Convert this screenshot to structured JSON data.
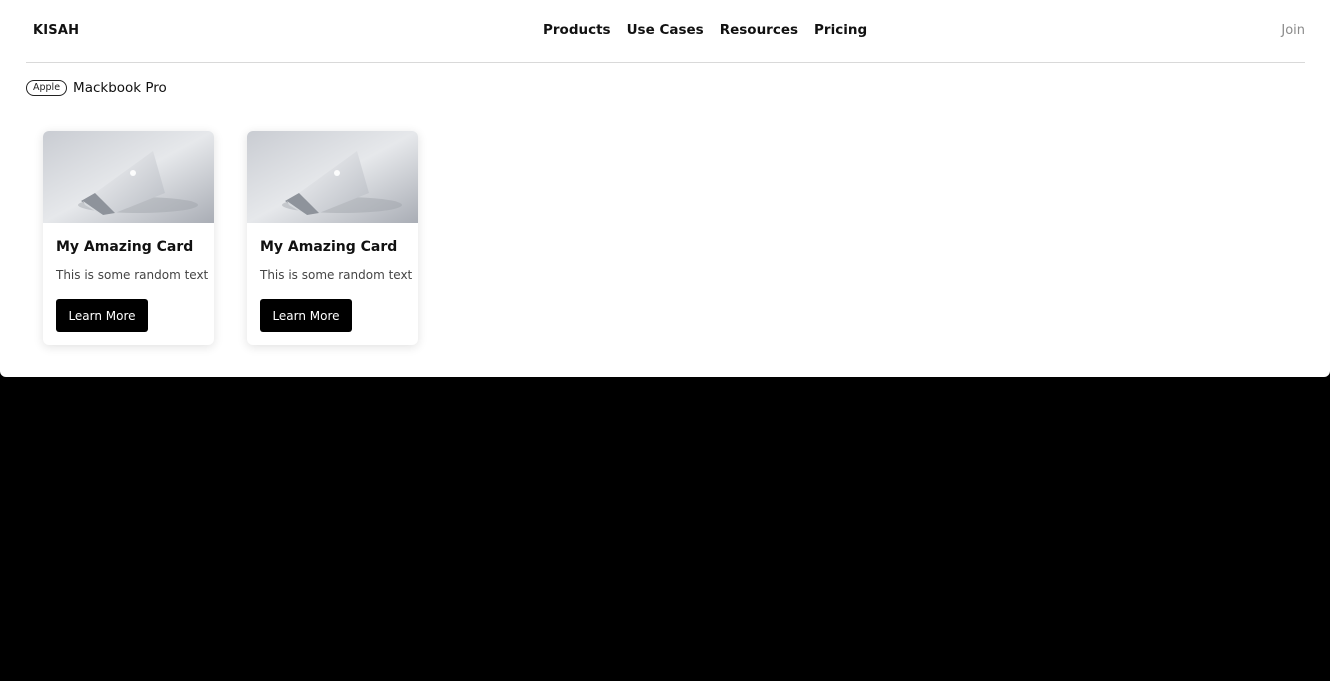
{
  "navbar": {
    "brand": "KISAH",
    "links": [
      {
        "label": "Products"
      },
      {
        "label": "Use Cases"
      },
      {
        "label": "Resources"
      },
      {
        "label": "Pricing"
      }
    ],
    "join_label": "Join"
  },
  "breadcrumb": {
    "badge": "Apple",
    "title": "Mackbook Pro"
  },
  "cards": [
    {
      "image": "laptop-image",
      "title": "My Amazing Card",
      "text": "This is some random text",
      "button": "Learn More"
    },
    {
      "image": "laptop-image",
      "title": "My Amazing Card",
      "text": "This is some random text",
      "button": "Learn More"
    }
  ],
  "colors": {
    "page_bg": "#ffffff",
    "outer_bg": "#000000",
    "button_bg": "#000000",
    "join_text": "#8a8a8a"
  }
}
